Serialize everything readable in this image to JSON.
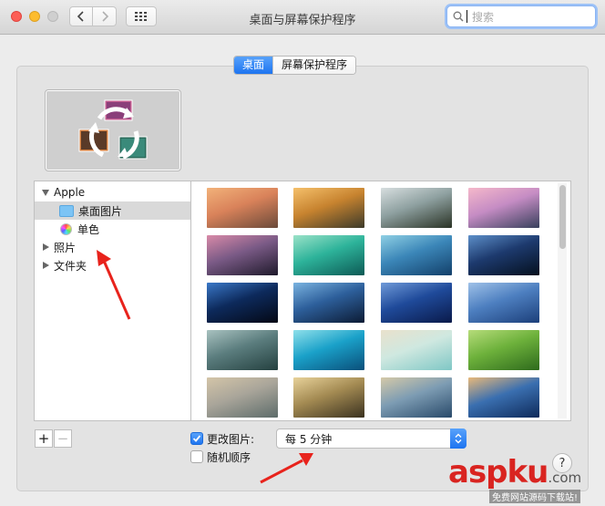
{
  "window": {
    "title": "桌面与屏幕保护程序"
  },
  "search": {
    "placeholder": "搜索"
  },
  "tabs": [
    {
      "label": "桌面",
      "active": true
    },
    {
      "label": "屏幕保护程序",
      "active": false
    }
  ],
  "sidebar": {
    "items": [
      {
        "label": "Apple",
        "expanded": true
      },
      {
        "label": "桌面图片",
        "selected": true
      },
      {
        "label": "单色"
      },
      {
        "label": "照片",
        "expanded": false
      },
      {
        "label": "文件夹",
        "expanded": false
      }
    ]
  },
  "controls": {
    "add_label": "+",
    "remove_label": "−",
    "change_picture_label": "更改图片:",
    "change_picture_checked": true,
    "interval_value": "每 5 分钟",
    "random_label": "随机顺序",
    "random_checked": false,
    "help_label": "?"
  },
  "watermark": {
    "brand": "aspku",
    "suffix": ".com",
    "sub": "免费网站源码下载站!"
  },
  "colors": {
    "accent": "#1d74f0",
    "annotation_arrow": "#e8231c"
  },
  "thumbnails": [
    [
      "#6b4a3a",
      "#d9825a",
      "#f2b27a"
    ],
    [
      "#3c3a2a",
      "#c7832f",
      "#f5c06b"
    ],
    [
      "#2a3325",
      "#8ea0a0",
      "#d7dedf"
    ],
    [
      "#38405c",
      "#c58cc4",
      "#f5b8ca"
    ],
    [
      "#1f1a2b",
      "#7a5a86",
      "#d98aa8"
    ],
    [
      "#0d5a55",
      "#2db39a",
      "#9be2c8"
    ],
    [
      "#13406a",
      "#3b86b8",
      "#8fd0e4"
    ],
    [
      "#05101e",
      "#1d3a6e",
      "#5d8fc9"
    ],
    [
      "#040814",
      "#0d2a5c",
      "#3a78c8"
    ],
    [
      "#0c1b34",
      "#2d5f9b",
      "#7ab3e0"
    ],
    [
      "#0a1a4a",
      "#1f4a9a",
      "#6f9ad8"
    ],
    [
      "#1c3f7a",
      "#4d7fc0",
      "#9fc1e8"
    ],
    [
      "#24403f",
      "#5b7d7e",
      "#a9c2c0"
    ],
    [
      "#0a4f7a",
      "#1aa1c9",
      "#8fe0ea"
    ],
    [
      "#7fc7c5",
      "#cfe8e0",
      "#e9e1cc"
    ],
    [
      "#2e6a1c",
      "#6db13b",
      "#b6dc7a"
    ],
    [
      "#5d6c6a",
      "#a9a59a",
      "#d4c5a8"
    ],
    [
      "#3b3220",
      "#a38a52",
      "#e8d29a"
    ],
    [
      "#294a6a",
      "#7d9cb3",
      "#d5c9a8"
    ],
    [
      "#0e2a5a",
      "#3a6fb0",
      "#e8b97a"
    ]
  ]
}
